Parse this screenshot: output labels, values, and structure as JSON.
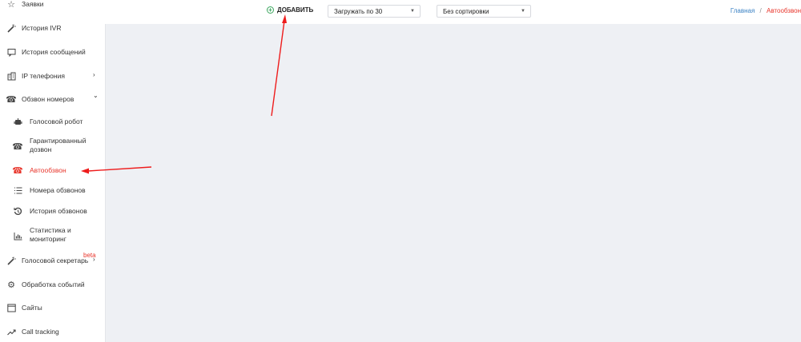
{
  "sidebar": {
    "items": [
      {
        "label": "Заявки",
        "icon": "star-icon"
      },
      {
        "label": "История IVR",
        "icon": "magic-wand-icon"
      },
      {
        "label": "История сообщений",
        "icon": "message-icon"
      },
      {
        "label": "IP телефония",
        "icon": "building-icon",
        "arrow": "›"
      },
      {
        "label": "Обзвон номеров",
        "icon": "phone-icon",
        "arrow": "⌄"
      },
      {
        "label": "Голосовой робот",
        "icon": "robot-icon"
      },
      {
        "label": "Гарантированный",
        "label2": "дозвон",
        "icon": "phone-icon"
      },
      {
        "label": "Автообзвон",
        "icon": "phone-icon",
        "active": true
      },
      {
        "label": "Номера обзвонов",
        "icon": "list-icon"
      },
      {
        "label": "История обзвонов",
        "icon": "history-icon"
      },
      {
        "label": "Статистика и",
        "label2": "мониторинг",
        "icon": "bar-chart-icon"
      },
      {
        "label": "Голосовой секретарь",
        "icon": "magic-wand-icon",
        "arrow": "›",
        "badge": "beta"
      },
      {
        "label": "Обработка событий",
        "icon": "gears-icon"
      },
      {
        "label": "Сайты",
        "icon": "browser-window-icon"
      },
      {
        "label": "Call tracking",
        "icon": "trend-icon"
      }
    ]
  },
  "toolbar": {
    "add_label": "ДОБАВИТЬ",
    "load_select": "Загружать по 30",
    "sort_select": "Без сортировки"
  },
  "breadcrumb": {
    "home": "Главная",
    "separator": "/",
    "current": "Автообзвон"
  },
  "colors": {
    "accent": "#e8352b",
    "link": "#3b82c4",
    "add_icon": "#3aa55d",
    "background": "#eef0f4"
  }
}
